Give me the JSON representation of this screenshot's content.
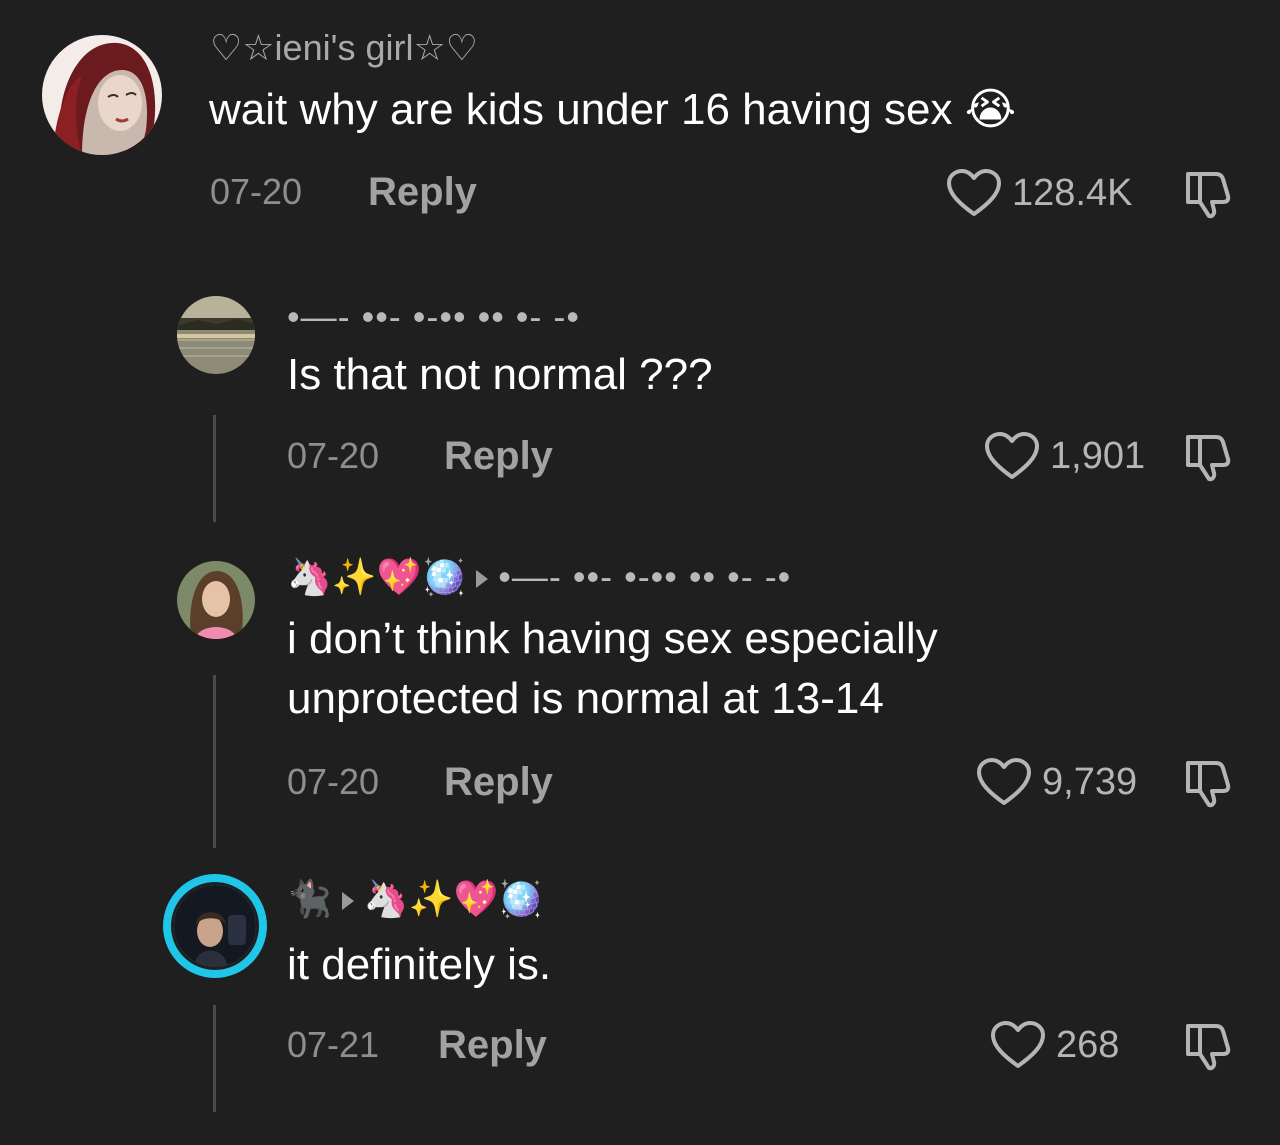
{
  "comments": [
    {
      "username": "♡☆ieni's girl☆♡",
      "text": "wait why are kids under 16 having sex 😭",
      "date": "07-20",
      "reply_label": "Reply",
      "likes": "128.4K"
    },
    {
      "username": "•—- ••- •-•• •• •- -•",
      "text": "Is that not normal ???",
      "date": "07-20",
      "reply_label": "Reply",
      "likes": "1,901"
    },
    {
      "username_from": "🦄✨💖🪩",
      "username_to": "•—- ••- •-•• •• •- -•",
      "text_line1": "i don’t think having sex especially",
      "text_line2": "unprotected is normal at 13-14",
      "date": "07-20",
      "reply_label": "Reply",
      "likes": "9,739"
    },
    {
      "username_from": "🐈‍⬛",
      "username_to": "🦄✨💖🪩",
      "text": "it definitely is.",
      "date": "07-21",
      "reply_label": "Reply",
      "likes": "268"
    }
  ],
  "colors": {
    "background": "#1f1f1f",
    "text": "#ffffff",
    "secondary": "#8e8e8e",
    "story_ring": "#1fc6e8"
  },
  "icons": [
    "heart-icon",
    "dislike-icon",
    "reply-arrow-icon"
  ]
}
